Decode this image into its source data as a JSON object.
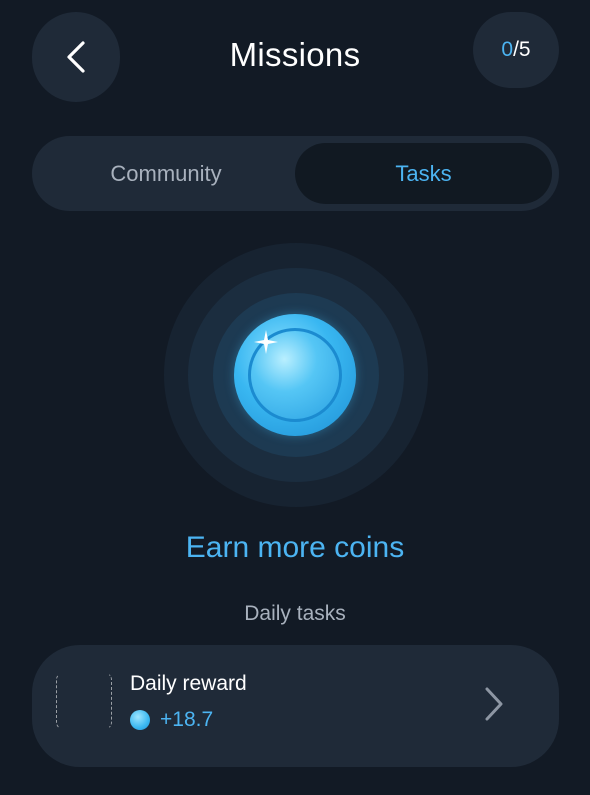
{
  "header": {
    "title": "Missions",
    "back_icon": "chevron-left-icon",
    "progress": {
      "done": "0",
      "separator": "/",
      "total": "5"
    }
  },
  "tabs": [
    {
      "label": "Community",
      "selected": false
    },
    {
      "label": "Tasks",
      "selected": true
    }
  ],
  "hero": {
    "icon": "coin-icon",
    "headline": "Earn more coins"
  },
  "section_label": "Daily tasks",
  "tasks": [
    {
      "title": "Daily reward",
      "reward": "+18.7",
      "reward_icon": "coin-icon",
      "action_icon": "chevron-right-icon"
    }
  ],
  "colors": {
    "background": "#121a25",
    "surface": "#1f2a38",
    "accent": "#4cb4f2",
    "muted_text": "#a8b1bd"
  }
}
